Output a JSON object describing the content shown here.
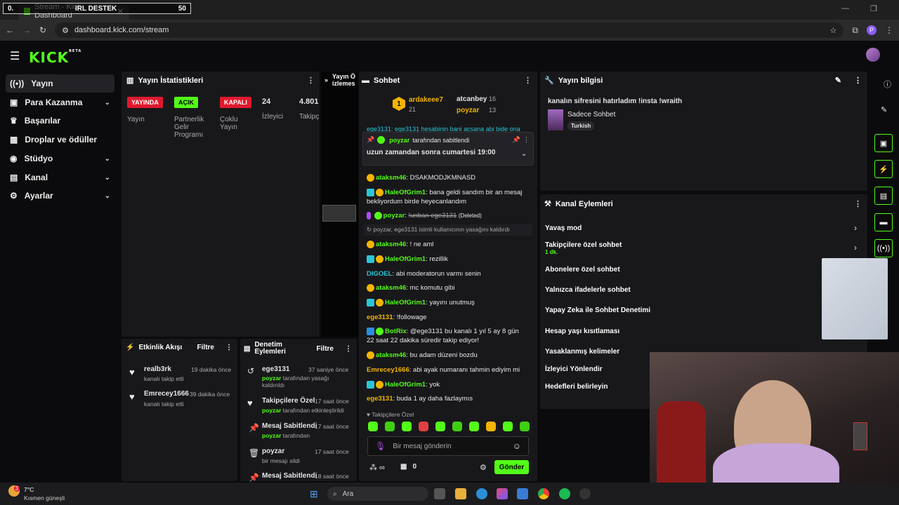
{
  "browser": {
    "tab_title": "Stream - Kick Dashboard",
    "overlay_left": "0.",
    "overlay_label": "IRL DESTEK",
    "overlay_value": "50",
    "url": "dashboard.kick.com/stream",
    "profile_initial": "P"
  },
  "header": {
    "logo": "KICK",
    "beta": "BETA"
  },
  "sidebar": {
    "items": [
      {
        "label": "Yayın",
        "icon": "broadcast-icon"
      },
      {
        "label": "Para Kazanma",
        "icon": "money-icon"
      },
      {
        "label": "Başarılar",
        "icon": "trophy-icon"
      },
      {
        "label": "Droplar ve ödüller",
        "icon": "gift-icon"
      },
      {
        "label": "Stüdyo",
        "icon": "studio-icon"
      },
      {
        "label": "Kanal",
        "icon": "channel-icon"
      },
      {
        "label": "Ayarlar",
        "icon": "gear-icon"
      }
    ]
  },
  "stats": {
    "title": "Yayın İstatistikleri",
    "badges": [
      "YAYINDA",
      "AÇIK",
      "KAPALI"
    ],
    "labels": [
      "Yayın",
      "Partnerlik Gelir Programı",
      "Çoklu Yayın"
    ],
    "viewers_value": "24",
    "viewers_label": "İzleyici",
    "followers_value": "4.801",
    "followers_label": "Takipç"
  },
  "preview": {
    "title": "Yayın Ö izlemes"
  },
  "chat": {
    "title": "Sohbet",
    "top": [
      {
        "name": "ardakeee7",
        "count": "21",
        "rank": "1"
      },
      {
        "name": "atcanbey",
        "count": "16"
      },
      {
        "name": "poyzar",
        "count": "13"
      }
    ],
    "cut_line": "ege3131: ege3131 hesabinin bani acsana abi bide ona",
    "pinned_by": "poyzar",
    "pinned_suffix": "tarafından sabitlendi",
    "pinned_text": "uzun zamandan sonra cumartesi 19:00",
    "messages": [
      {
        "user": "ataksm46",
        "text": "DSAKMODJKMNASD",
        "color": "#53fc18"
      },
      {
        "user": "HaleOfGrim1",
        "text": "bana geldi sandım bir an mesaj bekliyordum birde heyecanlandım",
        "color": "#53fc18"
      },
      {
        "user": "poyzar",
        "text": "!unban ege3131",
        "note": "(Deleted)",
        "color": "#53fc18"
      },
      {
        "user": "",
        "text": "poyzar, ege3131 isimli kullanıcının yasağını kaldırdı",
        "color": "#aaa"
      },
      {
        "user": "ataksm46",
        "text": "! ne aml",
        "color": "#53fc18"
      },
      {
        "user": "HaleOfGrim1",
        "text": "rezillik",
        "color": "#53fc18"
      },
      {
        "user": "DIGOEL",
        "text": "abi moderatorun varmı senin",
        "color": "#2ac6d6"
      },
      {
        "user": "ataksm46",
        "text": "mc komutu gibi",
        "color": "#53fc18"
      },
      {
        "user": "HaleOfGrim1",
        "text": "yayını unutmuş",
        "color": "#53fc18"
      },
      {
        "user": "ege3131",
        "text": "!followage",
        "color": "#f4b400"
      },
      {
        "user": "BotRix",
        "text": "@ege3131 bu kanalı 1 yıl 5 ay 8 gün 22 saat 22 dakika süredir takip ediyor!",
        "color": "#53fc18"
      },
      {
        "user": "ataksm46",
        "text": "bu adam düzeni bozdu",
        "color": "#53fc18"
      },
      {
        "user": "Emrecey1666",
        "text": "abi ayak numaranı tahmin ediyim mi",
        "color": "#f4b400"
      },
      {
        "user": "HaleOfGrim1",
        "text": "yok",
        "color": "#53fc18"
      },
      {
        "user": "ege3131",
        "text": "buda 1 ay daha fazlaymıs",
        "color": "#f4b400"
      }
    ],
    "followers_only": "Takipçilere Özel",
    "input_placeholder": "Bir mesaj gönderin",
    "points": "0",
    "send": "Gönder"
  },
  "stream_info": {
    "title": "Yayın bilgisi",
    "stream_title": "kanalın sifresini hatırladım !insta !wraith",
    "category": "Sadece Sohbet",
    "tag": "Turkish"
  },
  "channel_actions": {
    "title": "Kanal Eylemleri",
    "items": [
      "Yavaş mod",
      "Takipçilere özel sohbet",
      "Abonelere özel sohbet",
      "Yalnızca ifadelerle sohbet",
      "Yapay Zeka ile Sohbet Denetimi",
      "Hesap yaşı kısıtlaması",
      "Yasaklanmış kelimeler",
      "İzleyici Yönlendir",
      "Hedefleri belirleyin"
    ],
    "sub_label": "1 dk."
  },
  "activity": {
    "title": "Etkinlik Akışı",
    "filter": "Filtre",
    "items": [
      {
        "user": "realb3rk",
        "time": "19 dakika önce",
        "desc": "kanalı takip etti"
      },
      {
        "user": "Emrecey1666",
        "time": "39 dakika önce",
        "desc": "kanalı takip etti"
      }
    ]
  },
  "moderation": {
    "title": "Denetim Eylemleri",
    "filter": "Filtre",
    "items": [
      {
        "title": "ege3131",
        "time": "37 saniye önce",
        "by": "poyzar",
        "desc": "tarafından yasağı kaldırıldı"
      },
      {
        "title": "Takipçilere Özel",
        "time": "17 saat önce",
        "by": "poyzar",
        "desc": "tarafından etkinleştirildi"
      },
      {
        "title": "Mesaj Sabitlendi",
        "time": "17 saat önce",
        "by": "poyzar",
        "desc": "tarafından"
      },
      {
        "title": "poyzar",
        "time": "17 saat önce",
        "by": "",
        "desc": "bir mesajı sildi"
      },
      {
        "title": "Mesaj Sabitlendi",
        "time": "18 saat önce",
        "by": "",
        "desc": ""
      }
    ]
  },
  "taskbar": {
    "temp": "7°C",
    "weather": "Kısmen güneşli",
    "search": "Ara",
    "notif": "3"
  }
}
